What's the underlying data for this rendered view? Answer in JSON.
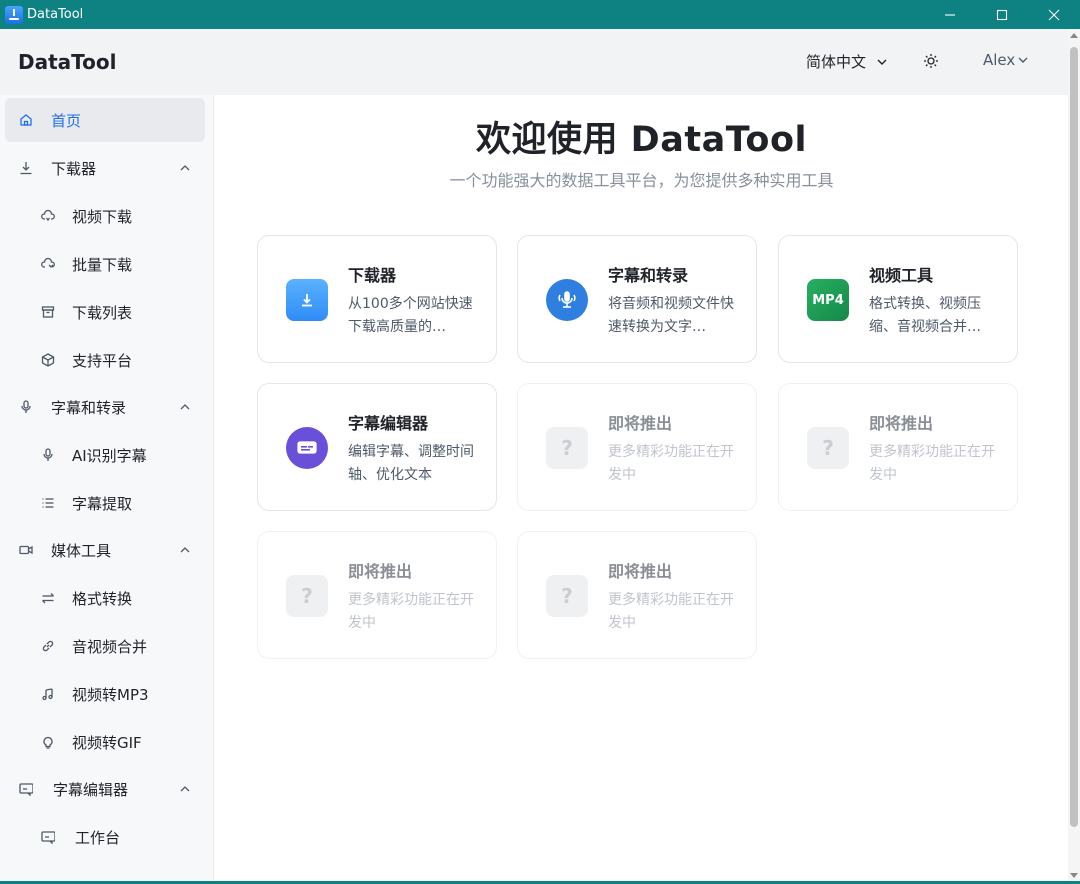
{
  "window": {
    "title": "DataTool"
  },
  "header": {
    "brand": "DataTool",
    "language": "简体中文",
    "user": "Alex"
  },
  "sidebar": {
    "items": [
      {
        "label": "首页",
        "icon": "home-icon",
        "active": true
      },
      {
        "label": "下载器",
        "icon": "download-icon",
        "expandable": true
      },
      {
        "label": "视频下载",
        "icon": "cloud-download-icon"
      },
      {
        "label": "批量下载",
        "icon": "cloud-batch-icon"
      },
      {
        "label": "下载列表",
        "icon": "archive-icon"
      },
      {
        "label": "支持平台",
        "icon": "cube-icon"
      },
      {
        "label": "字幕和转录",
        "icon": "mic-icon",
        "expandable": true
      },
      {
        "label": "AI识别字幕",
        "icon": "mic-icon"
      },
      {
        "label": "字幕提取",
        "icon": "list-icon"
      },
      {
        "label": "媒体工具",
        "icon": "video-camera-icon",
        "expandable": true
      },
      {
        "label": "格式转换",
        "icon": "swap-icon"
      },
      {
        "label": "音视频合并",
        "icon": "link-icon"
      },
      {
        "label": "视频转MP3",
        "icon": "music-note-icon"
      },
      {
        "label": "视频转GIF",
        "icon": "bulb-icon"
      },
      {
        "label": "字幕编辑器",
        "icon": "subtitle-icon",
        "expandable": true
      },
      {
        "label": "工作台",
        "icon": "subtitle-icon"
      }
    ]
  },
  "main": {
    "title": "欢迎使用 DataTool",
    "subtitle": "一个功能强大的数据工具平台，为您提供多种实用工具",
    "cards": [
      {
        "title": "下载器",
        "desc": "从100多个网站快速下载高质量的…",
        "icon": "download-box-icon",
        "color": "#3b9cff"
      },
      {
        "title": "字幕和转录",
        "desc": "将音频和视频文件快速转换为文字…",
        "icon": "mic-circle-icon",
        "color": "#2f7fe0"
      },
      {
        "title": "视频工具",
        "desc": "格式转换、视频压缩、音视频合并…",
        "icon": "mp4-icon",
        "icon_text": "MP4",
        "color": "#1e9e55"
      },
      {
        "title": "字幕编辑器",
        "desc": "编辑字幕、调整时间轴、优化文本",
        "icon": "subtitle-editor-icon",
        "color": "#6a4fd8"
      },
      {
        "title": "即将推出",
        "desc": "更多精彩功能正在开发中",
        "icon": "question-icon",
        "icon_text": "?",
        "disabled": true
      },
      {
        "title": "即将推出",
        "desc": "更多精彩功能正在开发中",
        "icon": "question-icon",
        "icon_text": "?",
        "disabled": true
      },
      {
        "title": "即将推出",
        "desc": "更多精彩功能正在开发中",
        "icon": "question-icon",
        "icon_text": "?",
        "disabled": true
      },
      {
        "title": "即将推出",
        "desc": "更多精彩功能正在开发中",
        "icon": "question-icon",
        "icon_text": "?",
        "disabled": true
      }
    ]
  }
}
